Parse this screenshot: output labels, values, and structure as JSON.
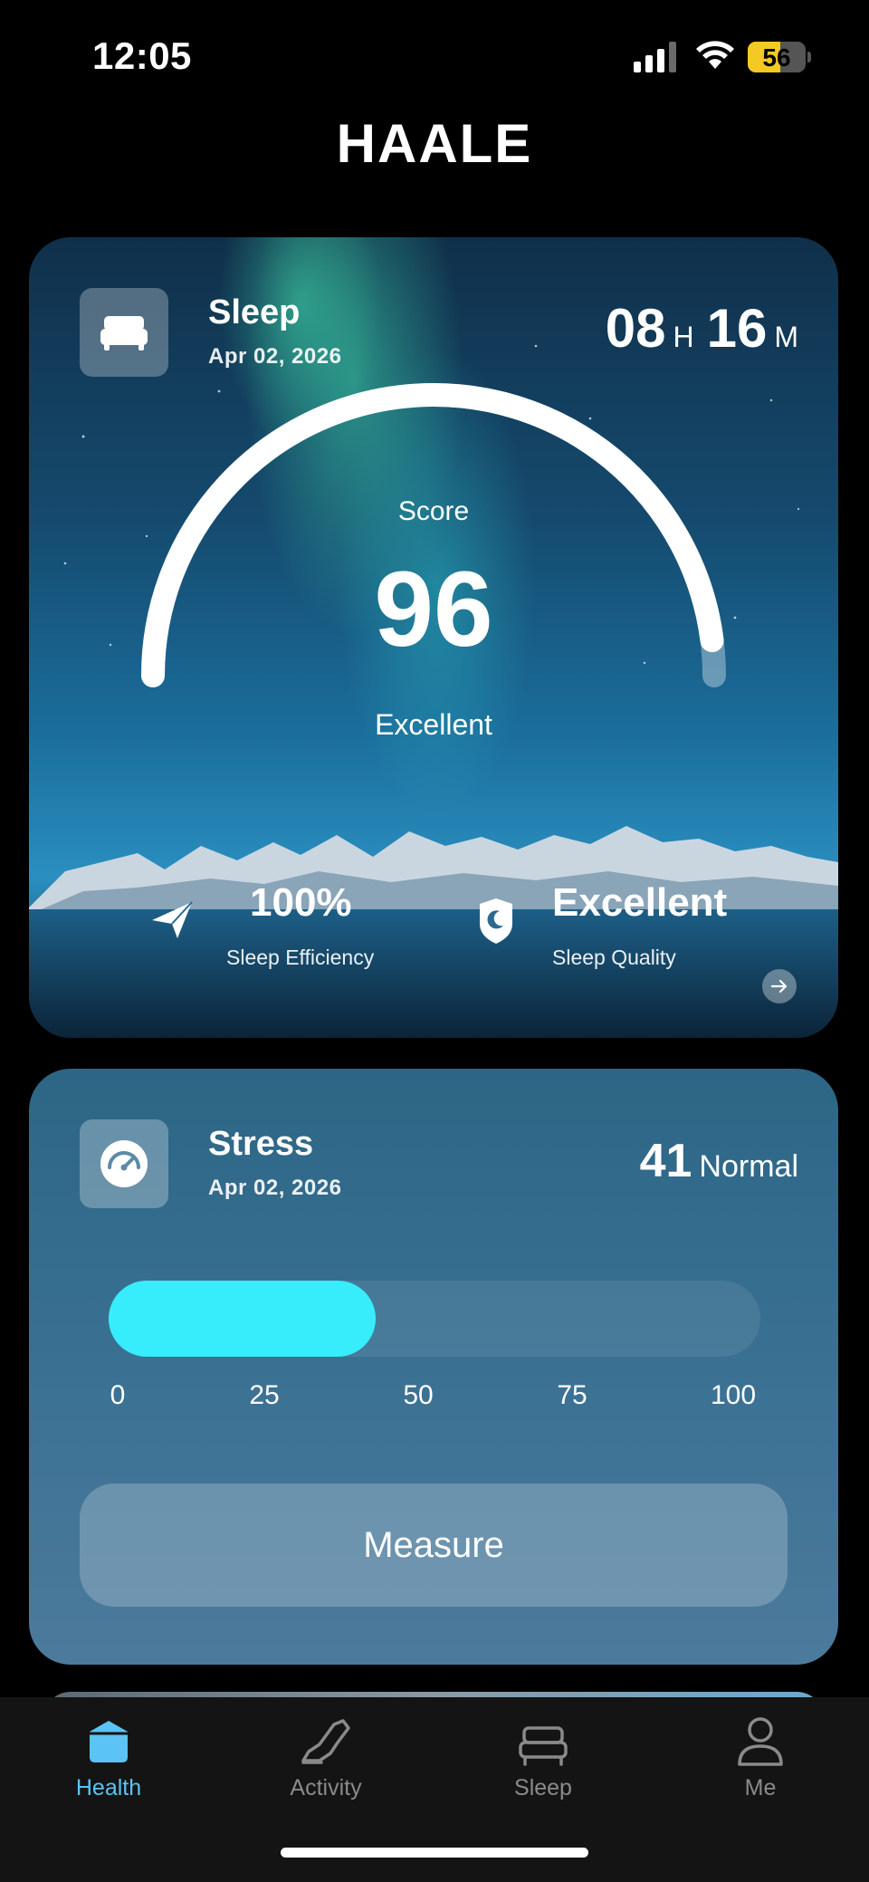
{
  "status_bar": {
    "time": "12:05",
    "battery": "56",
    "battery_color": "#f5c924"
  },
  "app": {
    "title": "HAALE"
  },
  "sleep_card": {
    "icon": "bed-icon",
    "title": "Sleep",
    "date": "Apr 02, 2026",
    "duration": {
      "hours": "08",
      "hours_unit": "H",
      "minutes": "16",
      "minutes_unit": "M"
    },
    "score_label": "Score",
    "score": "96",
    "score_fraction": 0.96,
    "score_rating": "Excellent",
    "metrics": [
      {
        "icon": "paper-plane-icon",
        "value": "100%",
        "label": "Sleep Efficiency"
      },
      {
        "icon": "moon-shield-icon",
        "value": "Excellent",
        "label": "Sleep Quality"
      }
    ],
    "more_icon": "arrow-right-icon"
  },
  "stress_card": {
    "icon": "gauge-icon",
    "title": "Stress",
    "date": "Apr 02, 2026",
    "value": "41",
    "status": "Normal",
    "level": 41,
    "scale": [
      "0",
      "25",
      "50",
      "75",
      "100"
    ],
    "bar_color": "#37ecfb",
    "measure_label": "Measure"
  },
  "tab_bar": {
    "active_color": "#5bc3f5",
    "tabs": [
      {
        "label": "Health",
        "icon": "health-icon",
        "active": true
      },
      {
        "label": "Activity",
        "icon": "shoe-icon",
        "active": false
      },
      {
        "label": "Sleep",
        "icon": "bed-icon",
        "active": false
      },
      {
        "label": "Me",
        "icon": "person-icon",
        "active": false
      }
    ]
  }
}
